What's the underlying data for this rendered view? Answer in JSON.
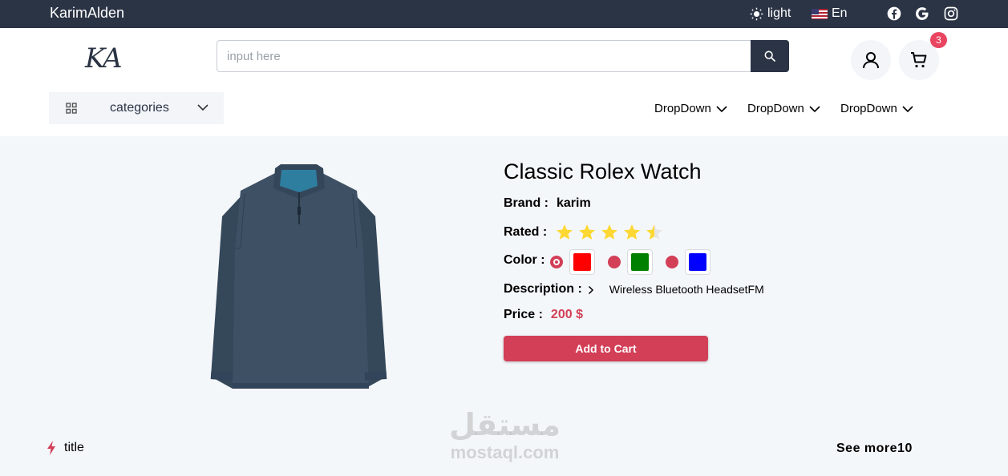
{
  "topbar": {
    "brand": "KarimAlden",
    "theme_label": "light",
    "lang_label": "En",
    "social_icons": [
      "facebook-icon",
      "google-icon",
      "instagram-icon"
    ]
  },
  "header": {
    "logo_text": "KA",
    "search_placeholder": "input here",
    "cart_count": "3",
    "categories_label": "categories",
    "dropdowns": [
      "DropDown",
      "DropDown",
      "DropDown"
    ]
  },
  "product": {
    "title": "Classic Rolex Watch",
    "brand_label": "Brand :",
    "brand_value": "karim",
    "rated_label": "Rated :",
    "rating": 4.5,
    "rating_max": 5,
    "color_label": "Color :",
    "colors": [
      "#ff0000",
      "#008000",
      "#0000ff"
    ],
    "selected_color_index": 0,
    "description_label": "Description :",
    "description_value": "Wireless Bluetooth HeadsetFM",
    "price_label": "Price :",
    "price_value": "200 $",
    "add_to_cart_label": "Add to Cart"
  },
  "section": {
    "title": "title",
    "see_more": "See more10"
  },
  "watermark": {
    "arabic": "مستقل",
    "latin": "mostaql.com"
  },
  "colors": {
    "dark": "#2b3445",
    "accent": "#d23f57",
    "badge": "#e94560",
    "star": "#fdd835",
    "background": "#f4f7fa"
  }
}
